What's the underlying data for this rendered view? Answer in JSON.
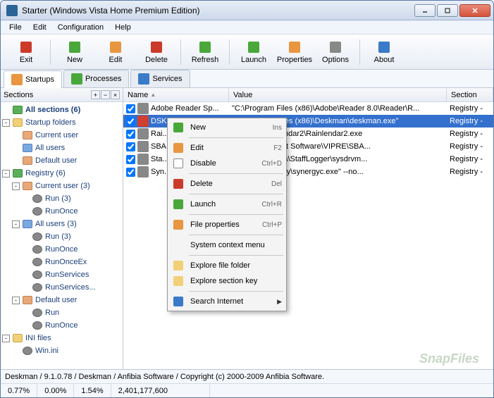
{
  "title": "Starter (Windows Vista Home Premium Edition)",
  "menu": [
    "File",
    "Edit",
    "Configuration",
    "Help"
  ],
  "toolbar": [
    {
      "label": "Exit",
      "color": "#cc3a2a"
    },
    {
      "label": "New",
      "color": "#4aa83a"
    },
    {
      "label": "Edit",
      "color": "#e89640"
    },
    {
      "label": "Delete",
      "color": "#cc3a2a"
    },
    {
      "label": "Refresh",
      "color": "#4aa83a"
    },
    {
      "label": "Launch",
      "color": "#4aa83a"
    },
    {
      "label": "Properties",
      "color": "#e89640"
    },
    {
      "label": "Options",
      "color": "#888"
    },
    {
      "label": "About",
      "color": "#3a7ac8"
    }
  ],
  "tabs": [
    {
      "label": "Startups",
      "active": true
    },
    {
      "label": "Processes",
      "active": false
    },
    {
      "label": "Services",
      "active": false
    }
  ],
  "sidebar": {
    "title": "Sections",
    "nodes": [
      {
        "indent": 0,
        "toggle": "",
        "icon": "all",
        "label": "All sections (6)",
        "bold": true
      },
      {
        "indent": 0,
        "toggle": "-",
        "icon": "folder",
        "label": "Startup folders"
      },
      {
        "indent": 1,
        "toggle": "",
        "icon": "user",
        "label": "Current user"
      },
      {
        "indent": 1,
        "toggle": "",
        "icon": "users",
        "label": "All users"
      },
      {
        "indent": 1,
        "toggle": "",
        "icon": "user",
        "label": "Default user"
      },
      {
        "indent": 0,
        "toggle": "-",
        "icon": "reg",
        "label": "Registry (6)"
      },
      {
        "indent": 1,
        "toggle": "-",
        "icon": "user",
        "label": "Current user (3)"
      },
      {
        "indent": 2,
        "toggle": "",
        "icon": "gear",
        "label": "Run (3)"
      },
      {
        "indent": 2,
        "toggle": "",
        "icon": "gear",
        "label": "RunOnce"
      },
      {
        "indent": 1,
        "toggle": "-",
        "icon": "users",
        "label": "All users (3)"
      },
      {
        "indent": 2,
        "toggle": "",
        "icon": "gear",
        "label": "Run (3)"
      },
      {
        "indent": 2,
        "toggle": "",
        "icon": "gear",
        "label": "RunOnce"
      },
      {
        "indent": 2,
        "toggle": "",
        "icon": "gear",
        "label": "RunOnceEx"
      },
      {
        "indent": 2,
        "toggle": "",
        "icon": "gear",
        "label": "RunServices"
      },
      {
        "indent": 2,
        "toggle": "",
        "icon": "gear",
        "label": "RunServices..."
      },
      {
        "indent": 1,
        "toggle": "-",
        "icon": "user",
        "label": "Default user"
      },
      {
        "indent": 2,
        "toggle": "",
        "icon": "gear",
        "label": "Run"
      },
      {
        "indent": 2,
        "toggle": "",
        "icon": "gear",
        "label": "RunOnce"
      },
      {
        "indent": 0,
        "toggle": "-",
        "icon": "folder",
        "label": "INI files"
      },
      {
        "indent": 1,
        "toggle": "",
        "icon": "gear",
        "label": "Win.ini"
      }
    ]
  },
  "columns": [
    "Name",
    "Value",
    "Section"
  ],
  "rows": [
    {
      "checked": true,
      "name": "Adobe Reader Sp...",
      "value": "\"C:\\Program Files (x86)\\Adobe\\Reader 8.0\\Reader\\R...",
      "section": "Registry -",
      "selected": false
    },
    {
      "checked": true,
      "name": "DSKM",
      "value": "\"C:\\Program Files (x86)\\Deskman\\deskman.exe\"",
      "section": "Registry -",
      "selected": true
    },
    {
      "checked": true,
      "name": "Rai...",
      "value": "es (x86)\\Rainlendar2\\Rainlendar2.exe",
      "section": "Registry -",
      "selected": false
    },
    {
      "checked": true,
      "name": "SBA...",
      "value": "es (x86)\\Sunbelt Software\\VIPRE\\SBA...",
      "section": "Registry -",
      "selected": false
    },
    {
      "checked": true,
      "name": "Sta...",
      "value": "es (x86)\\Almeza\\StaffLogger\\sysdrvm...",
      "section": "Registry -",
      "selected": false
    },
    {
      "checked": true,
      "name": "Syn...",
      "value": "es (x86)\\Synergy\\synergyc.exe\"  --no...",
      "section": "Registry -",
      "selected": false
    }
  ],
  "context_menu": [
    {
      "type": "item",
      "label": "New",
      "shortcut": "Ins",
      "icon": "green"
    },
    {
      "type": "sep"
    },
    {
      "type": "item",
      "label": "Edit",
      "shortcut": "F2",
      "icon": "orange"
    },
    {
      "type": "item",
      "label": "Disable",
      "shortcut": "Ctrl+D",
      "icon": "box"
    },
    {
      "type": "sep"
    },
    {
      "type": "item",
      "label": "Delete",
      "shortcut": "Del",
      "icon": "red"
    },
    {
      "type": "sep"
    },
    {
      "type": "item",
      "label": "Launch",
      "shortcut": "Ctrl+R",
      "icon": "green"
    },
    {
      "type": "sep"
    },
    {
      "type": "item",
      "label": "File properties",
      "shortcut": "Ctrl+P",
      "icon": "orange"
    },
    {
      "type": "sep"
    },
    {
      "type": "item",
      "label": "System context menu",
      "shortcut": "",
      "icon": ""
    },
    {
      "type": "sep"
    },
    {
      "type": "item",
      "label": "Explore file folder",
      "shortcut": "",
      "icon": "folder"
    },
    {
      "type": "item",
      "label": "Explore section key",
      "shortcut": "",
      "icon": "folder"
    },
    {
      "type": "sep"
    },
    {
      "type": "item",
      "label": "Search Internet",
      "shortcut": "",
      "icon": "blue",
      "arrow": true
    }
  ],
  "status1": "Deskman / 9.1.0.78 / Deskman / Anfibia Software / Copyright (c) 2000-2009 Anfibia Software.",
  "status2": [
    "0.77%",
    "0.00%",
    "1.54%",
    "2,401,177,600"
  ],
  "watermark": "SnapFiles"
}
